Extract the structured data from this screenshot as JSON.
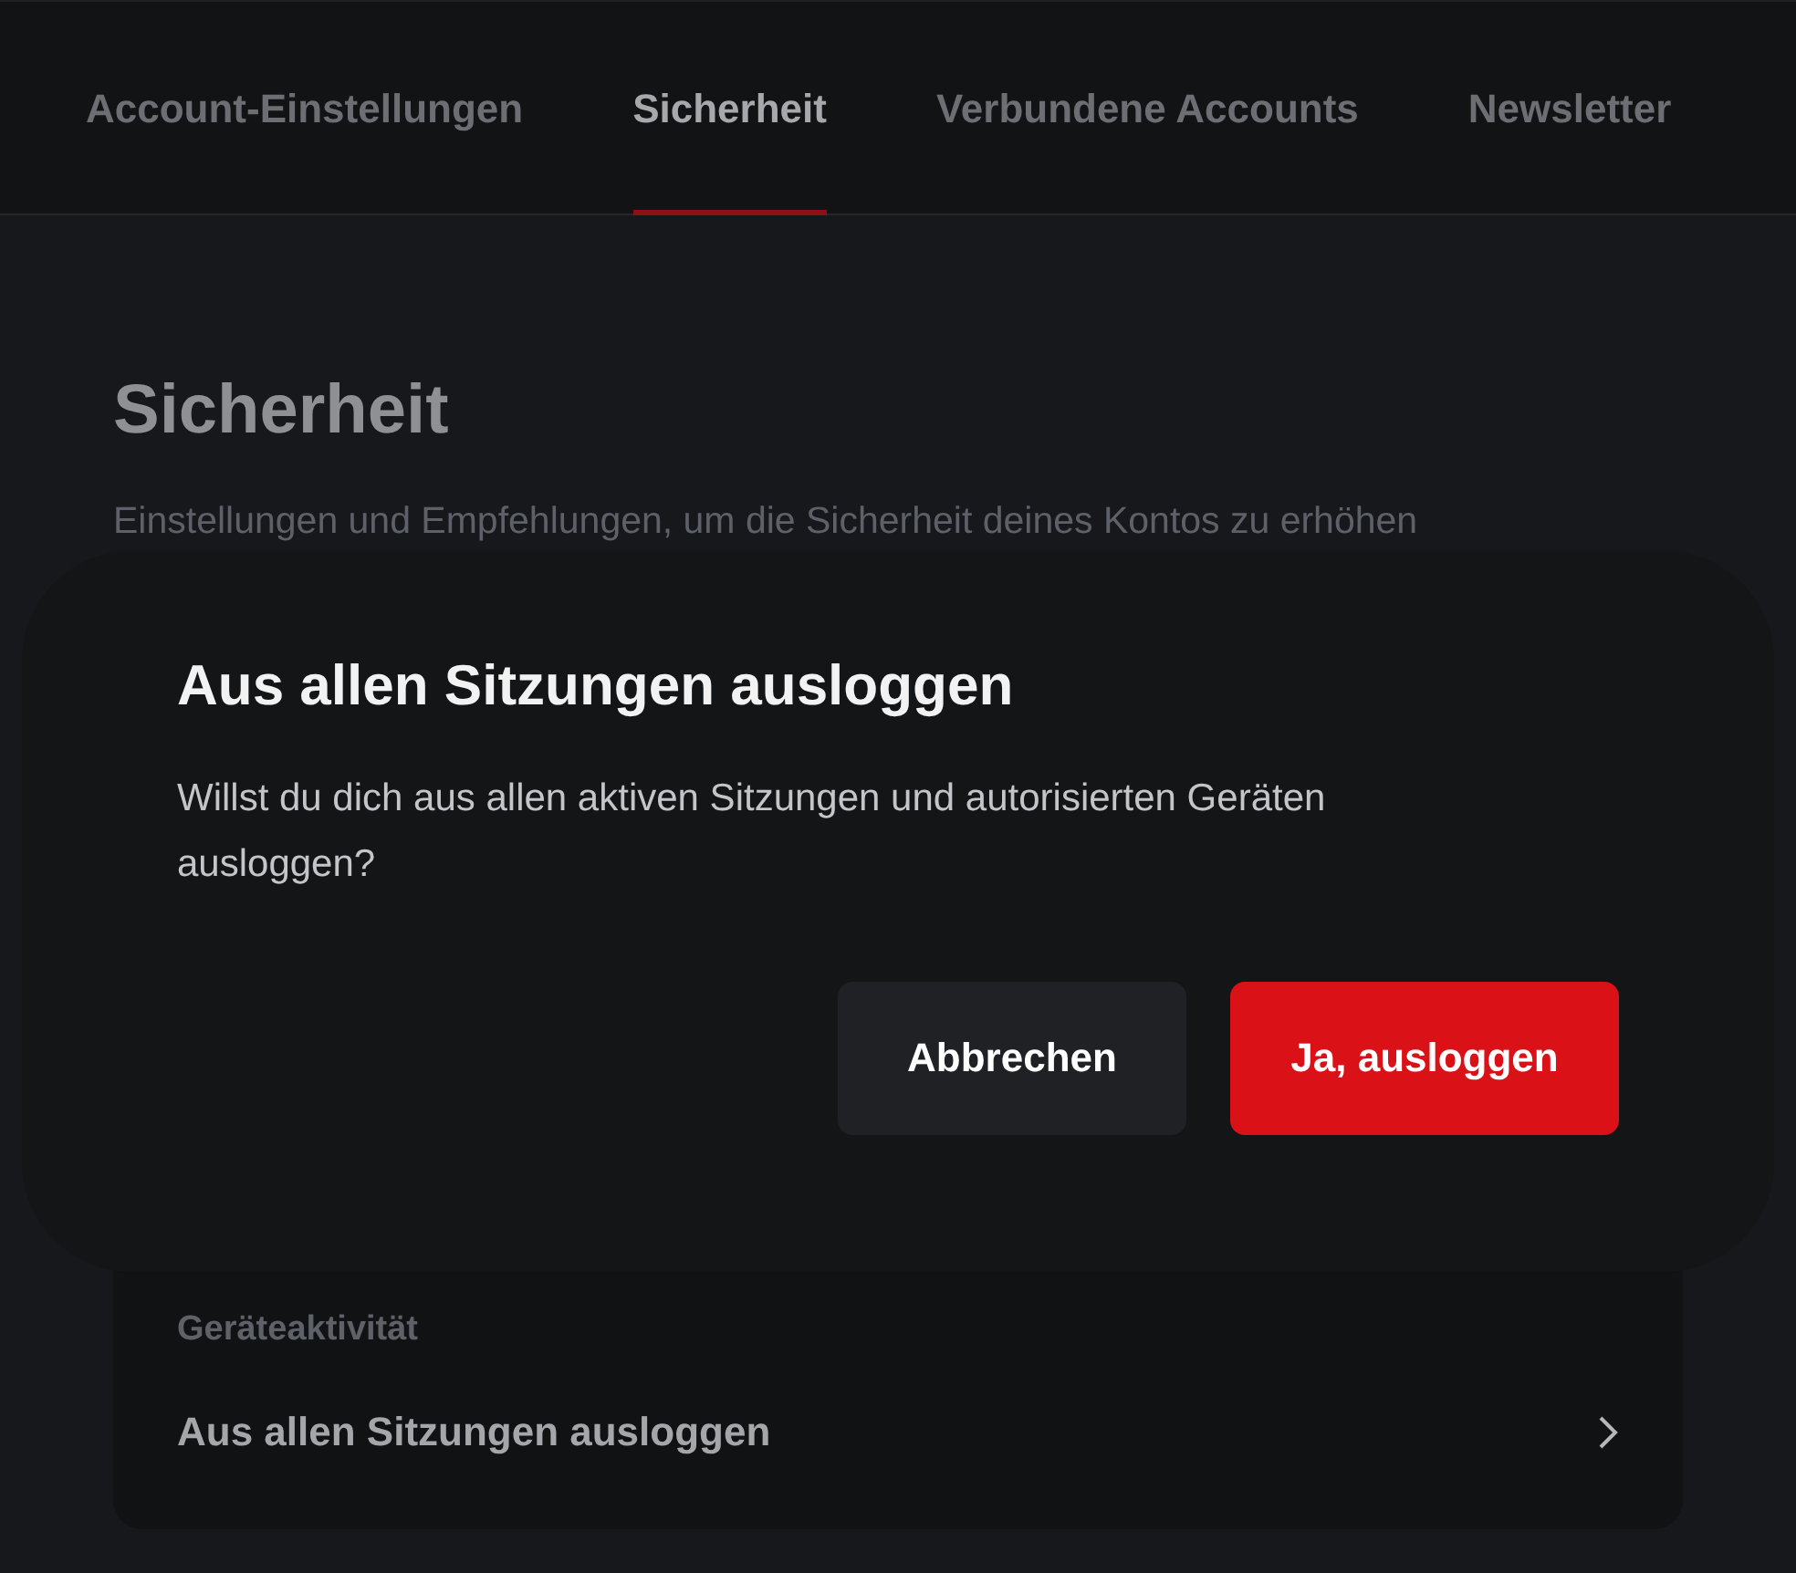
{
  "tabs": [
    {
      "label": "Account-Einstellungen",
      "selected": false
    },
    {
      "label": "Sicherheit",
      "selected": true
    },
    {
      "label": "Verbundene Accounts",
      "selected": false
    },
    {
      "label": "Newsletter",
      "selected": false
    }
  ],
  "page": {
    "title": "Sicherheit",
    "subtitle": "Einstellungen und Empfehlungen, um die Sicherheit deines Kontos zu erhöhen"
  },
  "section": {
    "label": "Geräteaktivität",
    "rows": [
      {
        "label": "Aus allen Sitzungen ausloggen"
      }
    ]
  },
  "dialog": {
    "title": "Aus allen Sitzungen ausloggen",
    "message": "Willst du dich aus allen aktiven Sitzungen und autorisierten Geräten ausloggen?",
    "buttons": [
      {
        "label": "Abbrechen",
        "kind": "secondary"
      },
      {
        "label": "Ja, ausloggen",
        "kind": "primary"
      }
    ]
  }
}
